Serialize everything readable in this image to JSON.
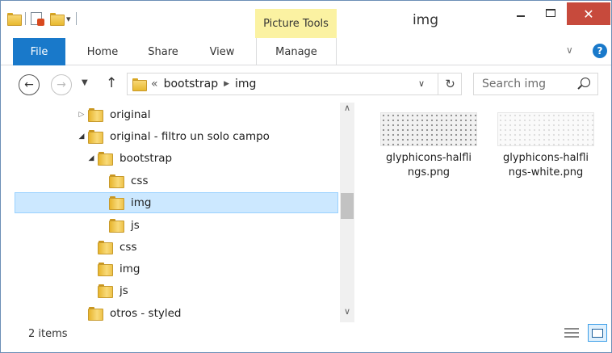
{
  "window": {
    "title": "img",
    "contextual_tab": "Picture Tools",
    "close_symbol": "✕"
  },
  "ribbon": {
    "tabs": [
      {
        "label": "File"
      },
      {
        "label": "Home"
      },
      {
        "label": "Share"
      },
      {
        "label": "View"
      },
      {
        "label": "Manage"
      }
    ]
  },
  "address": {
    "overflow": "«",
    "crumbs": [
      "bootstrap",
      "img"
    ],
    "refresh_symbol": "↻"
  },
  "search": {
    "placeholder": "Search img"
  },
  "tree": {
    "items": [
      {
        "label": "original",
        "expander": "▷"
      },
      {
        "label": "original - filtro un solo campo",
        "expander": "◢"
      },
      {
        "label": "bootstrap",
        "expander": "◢"
      },
      {
        "label": "css",
        "expander": ""
      },
      {
        "label": "img",
        "expander": ""
      },
      {
        "label": "js",
        "expander": ""
      },
      {
        "label": "css",
        "expander": ""
      },
      {
        "label": "img",
        "expander": ""
      },
      {
        "label": "js",
        "expander": ""
      },
      {
        "label": "otros - styled",
        "expander": ""
      }
    ],
    "selected_index": 4
  },
  "files": [
    {
      "name": "glyphicons-halflings.png",
      "line1": "glyphicons-halfli",
      "line2": "ngs.png"
    },
    {
      "name": "glyphicons-halflings-white.png",
      "line1": "glyphicons-halfli",
      "line2": "ngs-white.png"
    }
  ],
  "status": {
    "items_text": "2 items"
  },
  "colors": {
    "accent": "#1979ca",
    "contextual": "#fbf2a2",
    "close": "#c74a3c",
    "selection": "#cce8ff"
  }
}
